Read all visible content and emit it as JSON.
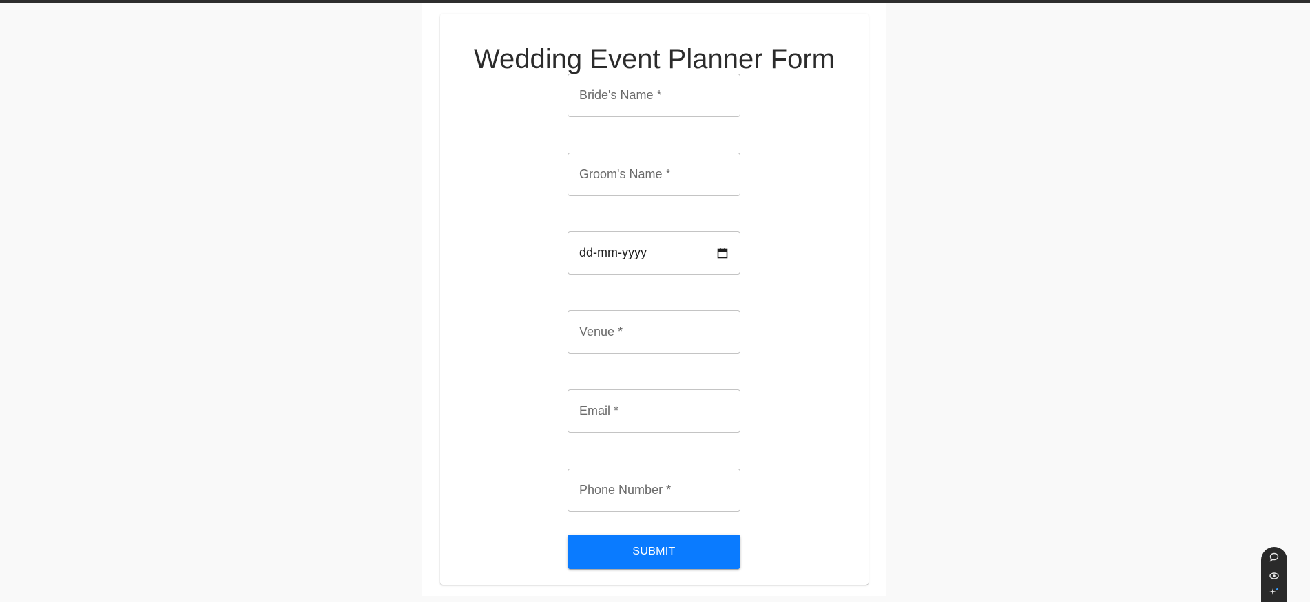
{
  "form": {
    "title": "Wedding Event Planner Form",
    "fields": {
      "bride": "Bride's Name *",
      "groom": "Groom's Name *",
      "date": "dd-mm-yyyy",
      "venue": "Venue *",
      "email": "Email *",
      "phone": "Phone Number *"
    },
    "submit_label": "SUBMIT"
  },
  "colors": {
    "accent": "#0a7bff",
    "background": "#f9f9f9",
    "card": "#ffffff"
  },
  "widget": {
    "icons": [
      "chat-icon",
      "eye-icon",
      "sparkle-icon"
    ]
  }
}
